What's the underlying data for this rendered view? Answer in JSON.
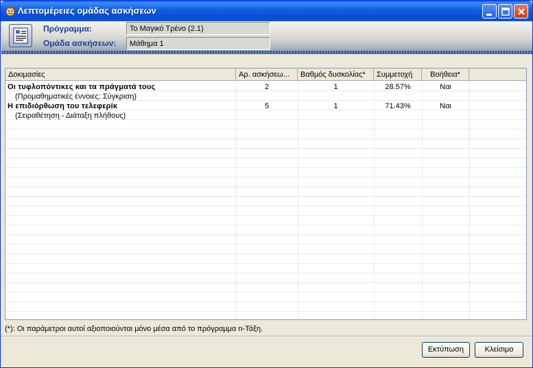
{
  "window": {
    "title": "Λεπτομέρειες ομάδας ασκήσεων"
  },
  "header": {
    "program_label": "Πρόγραμμα:",
    "program_value": "Το Μαγικό Τρένο (2.1)",
    "group_label": "Ομάδα ασκήσεων:",
    "group_value": "Μάθημα 1"
  },
  "table": {
    "columns": [
      "Δοκιμασίες",
      "Αρ. ασκήσεω...",
      "Βαθμός δυσκολίας*",
      "Συμμετοχή",
      "Βοήθεια*"
    ],
    "rows": [
      {
        "name": "Οι τυφλοπόντικες και τα πράγματά τους",
        "category": "(Προμαθηματικές έννοιες: Σύγκριση)",
        "exercises": "2",
        "difficulty": "1",
        "participation": "28.57%",
        "help": "Ναι"
      },
      {
        "name": "Η επιδιόρθωση του τελεφερίκ",
        "category": "(Σειραθέτηση - Διάταξη πλήθους)",
        "exercises": "5",
        "difficulty": "1",
        "participation": "71.43%",
        "help": "Ναι"
      }
    ]
  },
  "footer": {
    "note": "(*): Οι παράμετροι αυτοί αξιοποιούνται μόνο μέσα από το πρόγραμμα n-Τάξη.",
    "print_button": "Εκτύπωση",
    "close_button": "Κλείσιμο"
  }
}
